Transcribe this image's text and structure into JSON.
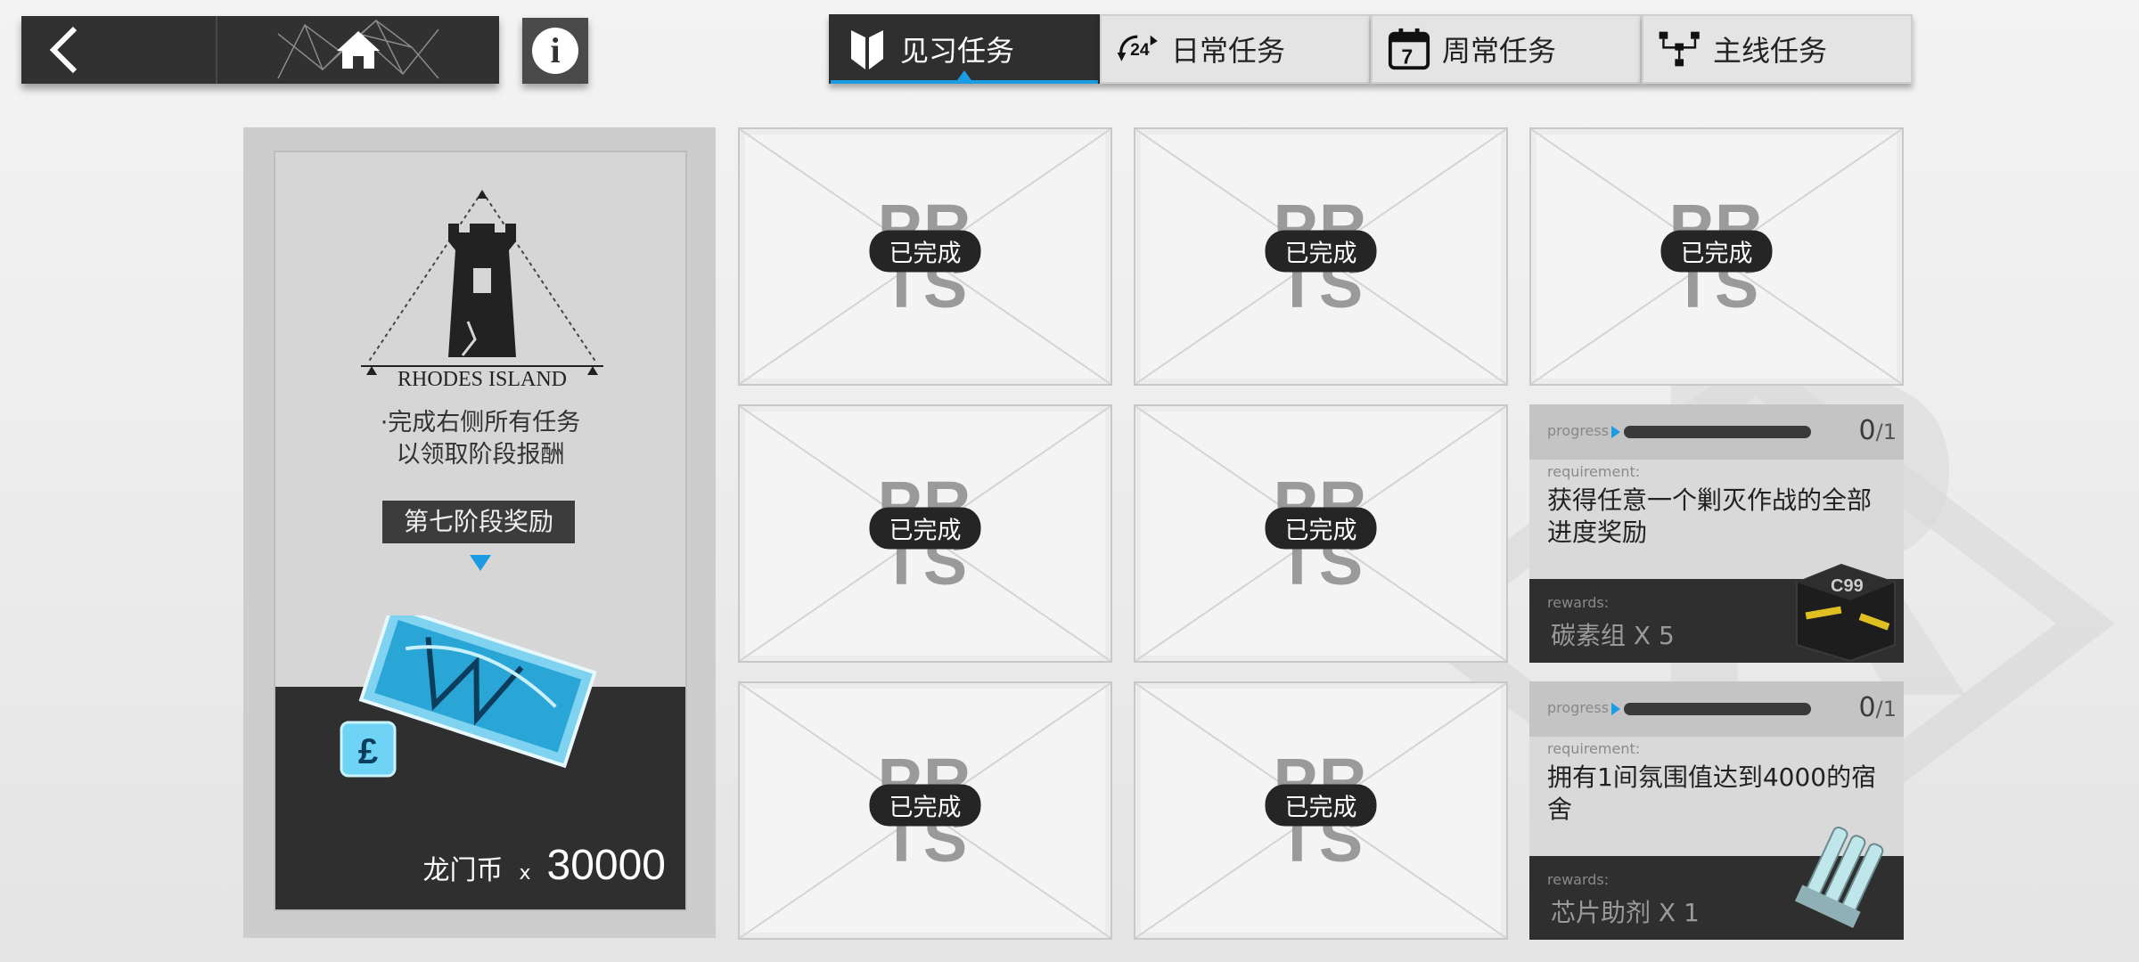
{
  "topbar": {
    "back_icon": "chevron-left-icon",
    "home_icon": "home-icon",
    "info_icon": "info-icon",
    "info_glyph": "i"
  },
  "tabs": [
    {
      "label": "见习任务",
      "icon": "trainee-badge-icon",
      "active": true
    },
    {
      "label": "日常任务",
      "icon": "24h-refresh-icon",
      "active": false
    },
    {
      "label": "周常任务",
      "icon": "calendar-7-icon",
      "active": false
    },
    {
      "label": "主线任务",
      "icon": "flowchart-icon",
      "active": false
    }
  ],
  "reward_panel": {
    "logo_text": "RHODES ISLAND",
    "description": "·完成右侧所有任务\n以领取阶段报酬",
    "stage_label": "第七阶段奖励",
    "reward_name": "龙门币",
    "reward_multiplier": "x",
    "reward_quantity": "30000"
  },
  "tasks": {
    "done_badge": "已完成",
    "watermark_line1": "PR",
    "watermark_line2": "TS",
    "open": [
      {
        "progress_label": "progress",
        "progress_current": "0",
        "progress_total": "1",
        "progress_fraction": 0,
        "requirement_label": "requirement:",
        "requirement": "获得任意一个剿灭作战的全部进度奖励",
        "rewards_label": "rewards:",
        "reward": "碳素组 X 5",
        "item_icon": "carbon-box-icon"
      },
      {
        "progress_label": "progress",
        "progress_current": "0",
        "progress_total": "1",
        "progress_fraction": 0,
        "requirement_label": "requirement:",
        "requirement": "拥有1间氛围值达到4000的宿舍",
        "rewards_label": "rewards:",
        "reward": "芯片助剂 X 1",
        "item_icon": "chip-catalyst-icon"
      }
    ]
  },
  "colors": {
    "accent": "#1a9be2",
    "dark": "#2f2f2f",
    "panel": "#cdcdcd"
  }
}
